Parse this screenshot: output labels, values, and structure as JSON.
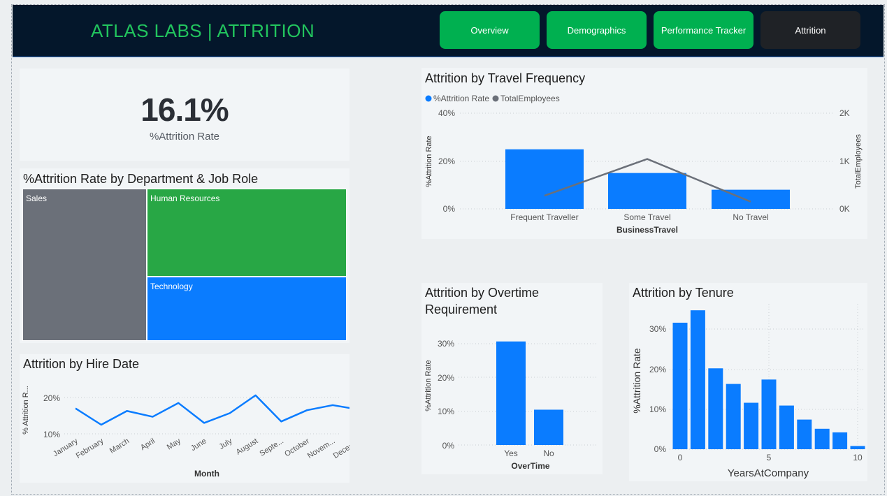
{
  "header": {
    "title": "ATLAS LABS | ATTRITION",
    "nav": [
      "Overview",
      "Demographics",
      "Performance Tracker",
      "Attrition"
    ],
    "active": "Attrition"
  },
  "kpi": {
    "value": "16.1%",
    "label": "%Attrition Rate"
  },
  "colors": {
    "blue": "#0a7cff",
    "gray": "#6b7079",
    "green": "#28a745",
    "header": "#04172b",
    "brand_green": "#22c55e"
  },
  "treemap": {
    "title": "%Attrition Rate by Department & Job Role",
    "tiles": [
      "Sales",
      "Human Resources",
      "Technology"
    ]
  },
  "hire": {
    "title": "Attrition by Hire Date",
    "xlabel": "Month",
    "ylabel": "% Attrition R...",
    "yticks": [
      "20%",
      "10%"
    ],
    "chart_data": {
      "type": "line",
      "categories": [
        "January",
        "February",
        "March",
        "April",
        "May",
        "June",
        "July",
        "August",
        "Septe...",
        "October",
        "Novem...",
        "Decem..."
      ],
      "values": [
        17,
        12.5,
        16.3,
        14.7,
        18.5,
        13,
        15.7,
        20.6,
        13.4,
        16.5,
        17.9,
        16.7
      ],
      "ylim": [
        10,
        20
      ]
    }
  },
  "travel": {
    "title": "Attrition by Travel Frequency",
    "legend": [
      "%Attrition Rate",
      "TotalEmployees"
    ],
    "ylabel_left": "%Attrition Rate",
    "ylabel_right": "TotalEmployees",
    "xlabel": "BusinessTravel",
    "yticks_left": [
      "40%",
      "20%",
      "0%"
    ],
    "yticks_right": [
      "2K",
      "1K",
      "0K"
    ],
    "chart_data": {
      "type": "bar",
      "categories": [
        "Frequent Traveller",
        "Some Travel",
        "No Travel"
      ],
      "series": [
        {
          "name": "%Attrition Rate",
          "values": [
            24.9,
            15.0,
            8.0
          ]
        },
        {
          "name": "TotalEmployees",
          "values": [
            277,
            1043,
            150
          ]
        }
      ],
      "ylim": [
        0,
        40
      ],
      "y2lim": [
        0,
        2000
      ]
    }
  },
  "overtime": {
    "title_line1": "Attrition by Overtime",
    "title_line2": "Requirement",
    "ylabel": "%Attrition Rate",
    "xlabel": "OverTime",
    "yticks": [
      "30%",
      "20%",
      "10%",
      "0%"
    ],
    "chart_data": {
      "type": "bar",
      "categories": [
        "Yes",
        "No"
      ],
      "values": [
        30.5,
        10.4
      ],
      "ylim": [
        0,
        35
      ]
    }
  },
  "tenure": {
    "title": "Attrition by Tenure",
    "ylabel": "%Attrition Rate",
    "xlabel": "YearsAtCompany",
    "yticks": [
      "30%",
      "20%",
      "10%",
      "0%"
    ],
    "xticks": [
      "0",
      "5",
      "10"
    ],
    "chart_data": {
      "type": "bar",
      "x": [
        0,
        1,
        2,
        3,
        4,
        5,
        6,
        7,
        8,
        9,
        10
      ],
      "values": [
        31.6,
        34.7,
        20.2,
        16.3,
        11.6,
        17.4,
        10.9,
        7.4,
        5.1,
        4.2,
        0.8
      ],
      "ylim": [
        0,
        35
      ]
    }
  }
}
